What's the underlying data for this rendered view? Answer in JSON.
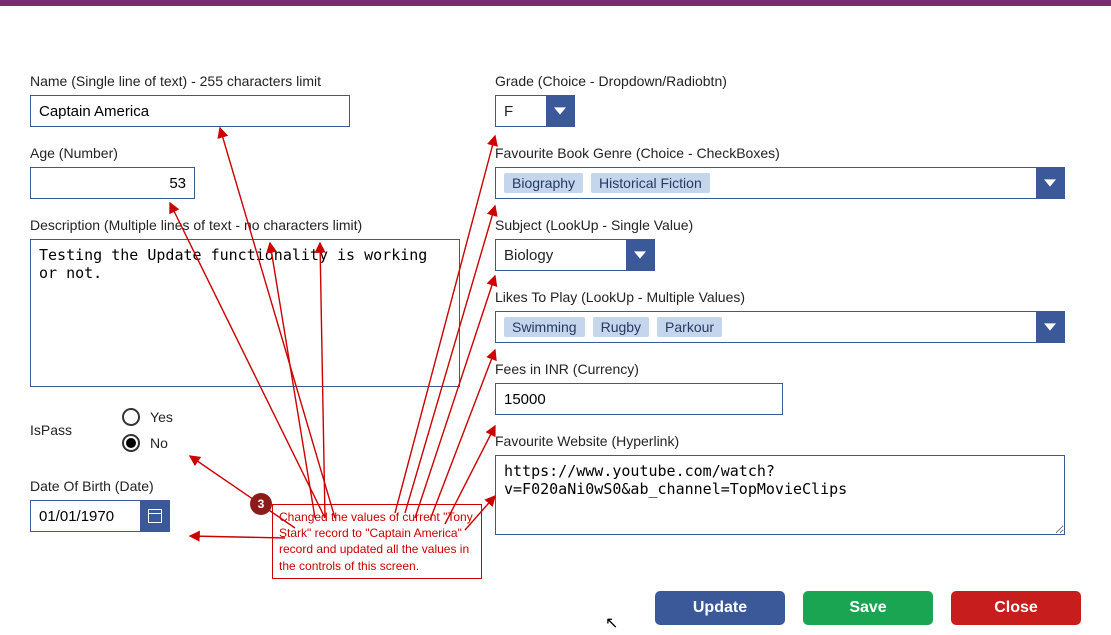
{
  "left": {
    "name_label": "Name (Single line of text) - 255 characters limit",
    "name_value": "Captain America",
    "age_label": "Age (Number)",
    "age_value": "53",
    "desc_label": "Description (Multiple lines of text - no characters limit)",
    "desc_value": "Testing the Update functionality is working or not.",
    "ispass_label": "IsPass",
    "radio_yes": "Yes",
    "radio_no": "No",
    "ispass_selected": "No",
    "dob_label": "Date Of Birth (Date)",
    "dob_value": "01/01/1970"
  },
  "right": {
    "grade_label": "Grade (Choice - Dropdown/Radiobtn)",
    "grade_value": "F",
    "genre_label": "Favourite Book Genre (Choice - CheckBoxes)",
    "genre_chips": [
      "Biography",
      "Historical Fiction"
    ],
    "subject_label": "Subject (LookUp - Single Value)",
    "subject_value": "Biology",
    "likes_label": "Likes To Play (LookUp - Multiple Values)",
    "likes_chips": [
      "Swimming",
      "Rugby",
      "Parkour"
    ],
    "fees_label": "Fees in INR (Currency)",
    "fees_value": "15000",
    "website_label": "Favourite Website (Hyperlink)",
    "website_value": "https://www.youtube.com/watch?v=F020aNi0wS0&ab_channel=TopMovieClips"
  },
  "buttons": {
    "update": "Update",
    "save": "Save",
    "close": "Close"
  },
  "annotation": {
    "number": "3",
    "text": "Changed the values of current \"Tony Stark\" record to \"Captain America\" record and updated all the values in the controls of this screen."
  }
}
